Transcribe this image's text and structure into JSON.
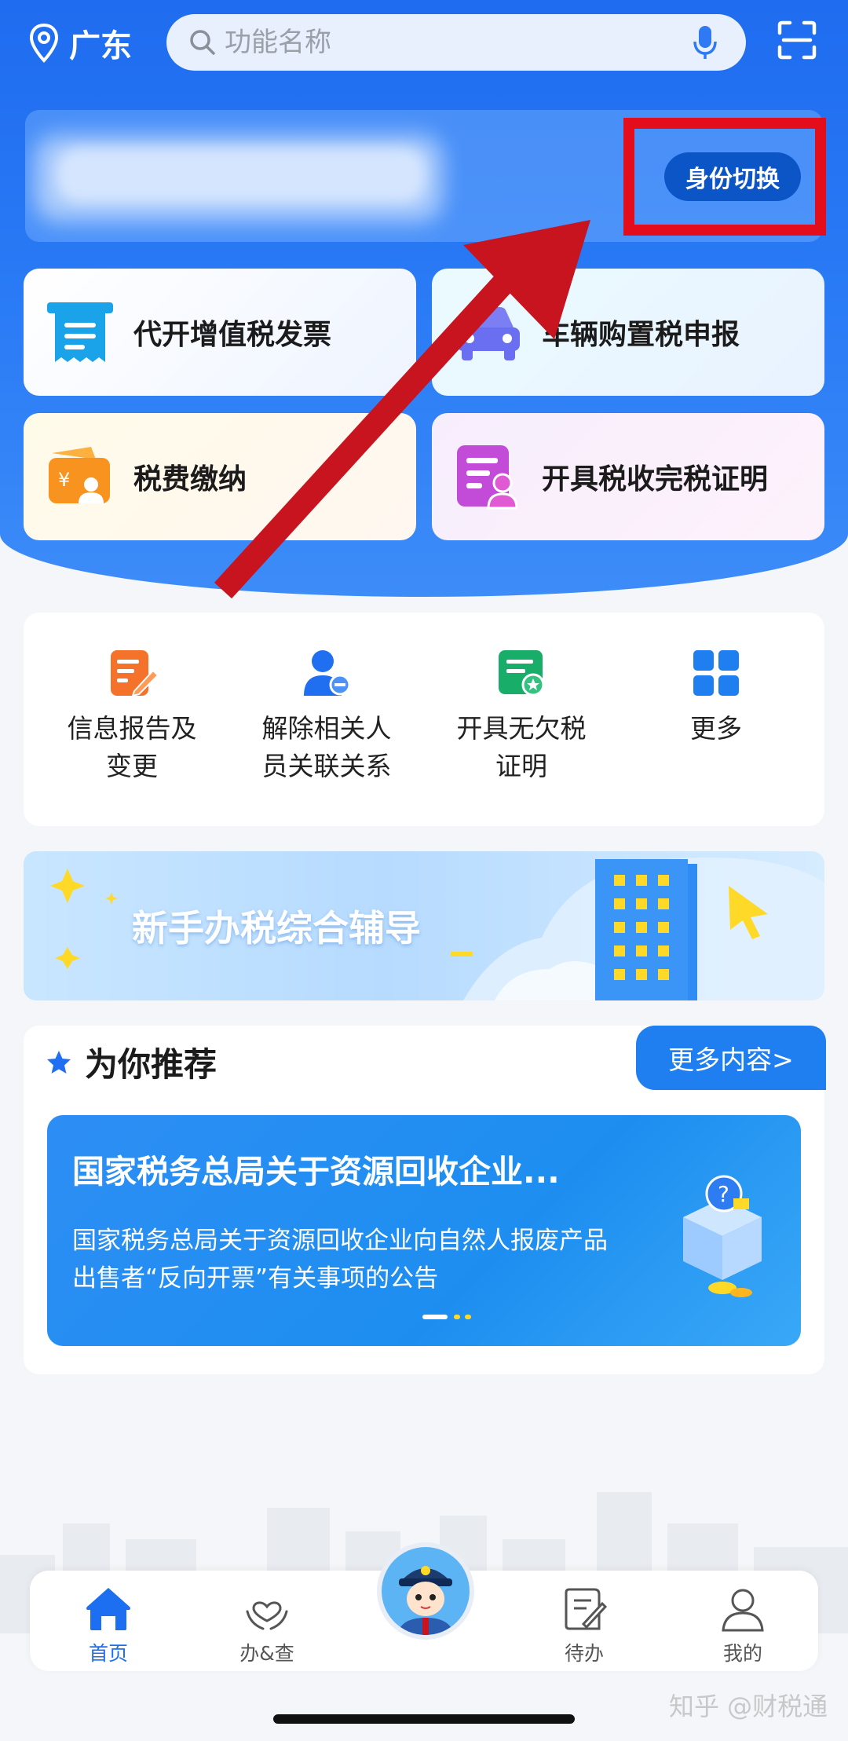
{
  "header": {
    "location": "广东",
    "search_placeholder": "功能名称"
  },
  "identity": {
    "switch_label": "身份切换"
  },
  "quick_services": [
    {
      "label": "代开增值税发票",
      "icon": "invoice-icon",
      "color": "#1aa3e8"
    },
    {
      "label": "车辆购置税申报",
      "icon": "car-icon",
      "color": "#6a6ff2"
    },
    {
      "label": "税费缴纳",
      "icon": "payment-icon",
      "color": "#f7931e"
    },
    {
      "label": "开具税收完税证明",
      "icon": "certificate-icon",
      "color": "#c24bd8"
    }
  ],
  "shortcuts": [
    {
      "label": "信息报告及\n变更",
      "icon": "edit-document-icon",
      "color": "#f5722a"
    },
    {
      "label": "解除相关人\n员关联关系",
      "icon": "remove-user-icon",
      "color": "#1f6ff0"
    },
    {
      "label": "开具无欠税\n证明",
      "icon": "certificate-star-icon",
      "color": "#19ad6a"
    },
    {
      "label": "更多",
      "icon": "grid-icon",
      "color": "#1f7ff0"
    }
  ],
  "banner": {
    "title": "新手办税综合辅导"
  },
  "recommend": {
    "title": "为你推荐",
    "more_label": "更多内容>",
    "news_title": "国家税务总局关于资源回收企业...",
    "news_body": "国家税务总局关于资源回收企业向自然人报废产品出售者“反向开票”有关事项的公告"
  },
  "tabbar": [
    {
      "label": "首页",
      "icon": "home-icon",
      "active": true
    },
    {
      "label": "办&查",
      "icon": "heart-hands-icon",
      "active": false
    },
    {
      "label": "待办",
      "icon": "todo-icon",
      "active": false
    },
    {
      "label": "我的",
      "icon": "profile-icon",
      "active": false
    }
  ],
  "watermark": "知乎 @财税通",
  "colors": {
    "primary": "#1f6cf0",
    "highlight": "#e40d1c",
    "arrow": "#c8141e"
  }
}
